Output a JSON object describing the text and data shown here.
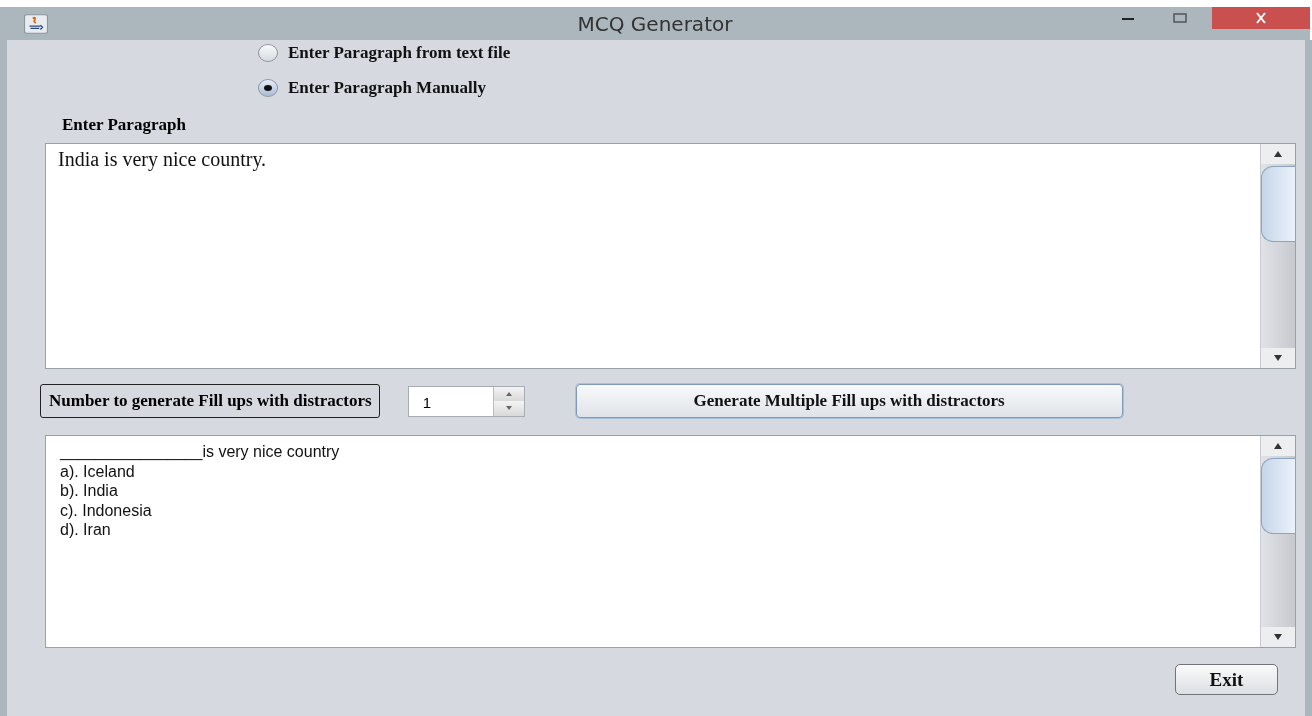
{
  "window": {
    "title": "MCQ Generator"
  },
  "input_mode": [
    {
      "label": "Enter Paragraph from text file",
      "selected": false
    },
    {
      "label": "Enter Paragraph Manually",
      "selected": true
    }
  ],
  "paragraph_label": "Enter Paragraph",
  "paragraph": {
    "value": "India is very nice country."
  },
  "count_label": "Number to generate Fill ups with distractors",
  "count_spinner": {
    "value": "1"
  },
  "generate_button": "Generate Multiple Fill ups with distractors",
  "output_lines": [
    "________________is very nice country",
    "a). Iceland",
    "b). India",
    "c). Indonesia",
    "d). Iran"
  ],
  "exit_button": "Exit"
}
